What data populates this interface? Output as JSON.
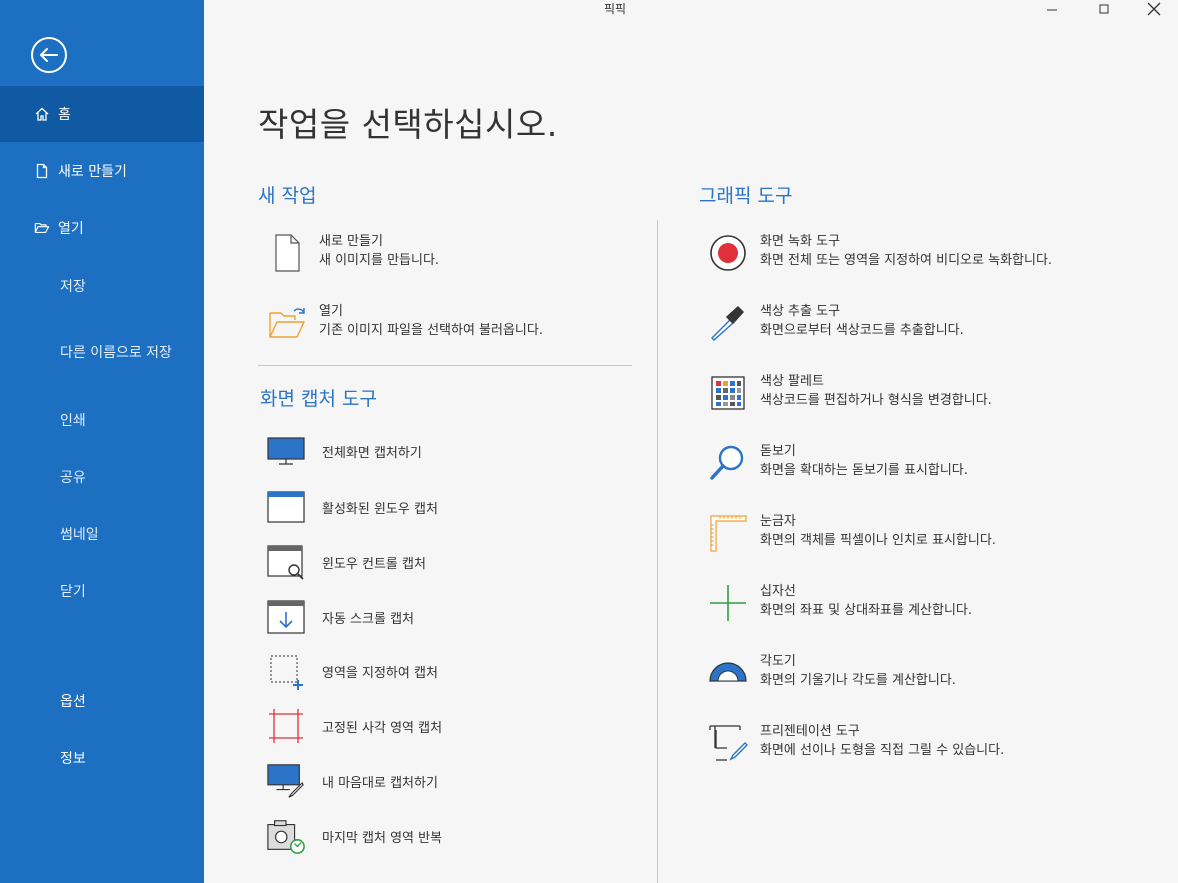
{
  "window": {
    "title": "픽픽",
    "minimize_icon": "minimize-icon",
    "maximize_icon": "maximize-icon",
    "close_icon": "close-icon"
  },
  "sidebar": {
    "back_icon": "back-arrow-icon",
    "items": [
      {
        "label": "홈",
        "icon": "home-icon",
        "selected": true
      },
      {
        "label": "새로 만들기",
        "icon": "new-file-icon"
      },
      {
        "label": "열기",
        "icon": "open-folder-icon"
      },
      {
        "label": "저장"
      },
      {
        "label": "다른 이름으로 저장"
      },
      {
        "label": "인쇄"
      },
      {
        "label": "공유"
      },
      {
        "label": "썸네일"
      },
      {
        "label": "닫기"
      },
      {
        "label": "옵션"
      },
      {
        "label": "정보"
      }
    ],
    "colors": {
      "background": "#1d6fc1",
      "selected": "#0f5aa2"
    }
  },
  "main": {
    "heading": "작업을 선택하십시오.",
    "new_task": {
      "title": "새 작업",
      "items": [
        {
          "name": "새로 만들기",
          "desc": "새 이미지를 만듭니다.",
          "icon": "blank-document-icon"
        },
        {
          "name": "열기",
          "desc": "기존 이미지 파일을 선택하여 불러옵니다.",
          "icon": "open-folder-icon"
        }
      ]
    },
    "capture": {
      "title": "화면 캡처 도구",
      "items": [
        {
          "label": "전체화면 캡처하기",
          "icon": "monitor-icon"
        },
        {
          "label": "활성화된 윈도우 캡처",
          "icon": "window-icon"
        },
        {
          "label": "윈도우 컨트롤 캡처",
          "icon": "window-control-icon"
        },
        {
          "label": "자동 스크롤 캡처",
          "icon": "scroll-capture-icon"
        },
        {
          "label": "영역을 지정하여 캡처",
          "icon": "region-capture-icon"
        },
        {
          "label": "고정된 사각 영역 캡처",
          "icon": "fixed-region-icon"
        },
        {
          "label": "내 마음대로 캡처하기",
          "icon": "freehand-capture-icon"
        },
        {
          "label": "마지막 캡처 영역 반복",
          "icon": "repeat-capture-icon"
        }
      ]
    },
    "graphic": {
      "title": "그래픽 도구",
      "items": [
        {
          "name": "화면 녹화 도구",
          "desc": "화면 전체 또는 영역을 지정하여 비디오로 녹화합니다.",
          "icon": "record-icon"
        },
        {
          "name": "색상 추출 도구",
          "desc": "화면으로부터 색상코드를 추출합니다.",
          "icon": "eyedropper-icon"
        },
        {
          "name": "색상 팔레트",
          "desc": "색상코드를 편집하거나 형식을 변경합니다.",
          "icon": "palette-icon"
        },
        {
          "name": "돋보기",
          "desc": "화면을 확대하는 돋보기를 표시합니다.",
          "icon": "magnifier-icon"
        },
        {
          "name": "눈금자",
          "desc": "화면의 객체를 픽셀이나 인치로 표시합니다.",
          "icon": "ruler-icon"
        },
        {
          "name": "십자선",
          "desc": "화면의 좌표 및 상대좌표를 계산합니다.",
          "icon": "crosshair-icon"
        },
        {
          "name": "각도기",
          "desc": "화면의 기울기나 각도를 계산합니다.",
          "icon": "protractor-icon"
        },
        {
          "name": "프리젠테이션 도구",
          "desc": "화면에 선이나 도형을 직접 그릴 수 있습니다.",
          "icon": "presentation-icon"
        }
      ]
    },
    "colors": {
      "accent": "#2b74c7",
      "record": "#e0313a",
      "crosshair": "#2e9e43",
      "ruler": "#f0a030"
    }
  }
}
